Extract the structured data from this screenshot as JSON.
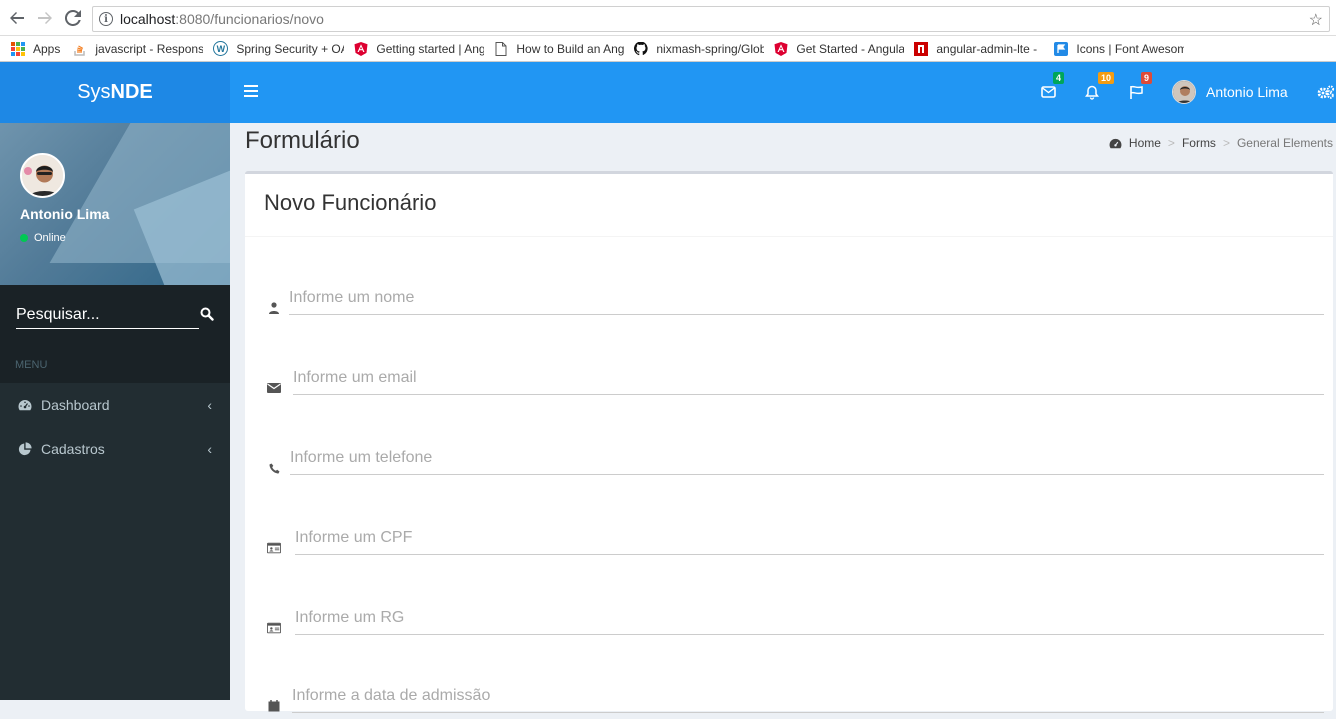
{
  "browser": {
    "url_host": "localhost",
    "url_path": ":8080/funcionarios/novo",
    "bookmarks": [
      {
        "label": "Apps",
        "icon": "apps-grid-icon"
      },
      {
        "label": "javascript - Respons",
        "icon": "stackoverflow-icon"
      },
      {
        "label": "Spring Security + OA",
        "icon": "wordpress-icon"
      },
      {
        "label": "Getting started | Ang",
        "icon": "angular-icon"
      },
      {
        "label": "How to Build an Ang",
        "icon": "document-icon"
      },
      {
        "label": "nixmash-spring/Glob",
        "icon": "github-icon"
      },
      {
        "label": "Get Started - Angula",
        "icon": "angular-icon"
      },
      {
        "label": "angular-admin-lte -",
        "icon": "npm-icon"
      },
      {
        "label": "Icons | Font Awesom",
        "icon": "flag-icon"
      }
    ]
  },
  "app": {
    "logo_prefix": "Sys",
    "logo_bold": "NDE",
    "topbar": {
      "messages_count": "4",
      "notifications_count": "10",
      "tasks_count": "9",
      "user_name": "Antonio Lima"
    },
    "sidebar": {
      "user_name": "Antonio Lima",
      "status": "Online",
      "search_placeholder": "Pesquisar...",
      "menu_header": "MENU",
      "items": [
        {
          "label": "Dashboard",
          "icon": "dashboard-icon"
        },
        {
          "label": "Cadastros",
          "icon": "pie-chart-icon"
        }
      ]
    },
    "content": {
      "page_title": "Formulário",
      "breadcrumb": [
        "Home",
        "Forms",
        "General Elements"
      ],
      "box_title": "Novo Funcionário",
      "fields": [
        {
          "placeholder": "Informe um nome",
          "icon": "user-icon"
        },
        {
          "placeholder": "Informe um email",
          "icon": "envelope-icon"
        },
        {
          "placeholder": "Informe um telefone",
          "icon": "phone-icon"
        },
        {
          "placeholder": "Informe um CPF",
          "icon": "id-card-icon"
        },
        {
          "placeholder": "Informe um RG",
          "icon": "id-card-icon"
        },
        {
          "placeholder": "Informe a data de admissão",
          "icon": "calendar-icon"
        }
      ]
    },
    "colors": {
      "topbar": "#2196f3",
      "logo_bar": "#1e88e5",
      "sidebar": "#222d32",
      "badge_green": "#00a65a",
      "badge_orange": "#f39c12",
      "badge_red": "#dd4b39"
    }
  }
}
